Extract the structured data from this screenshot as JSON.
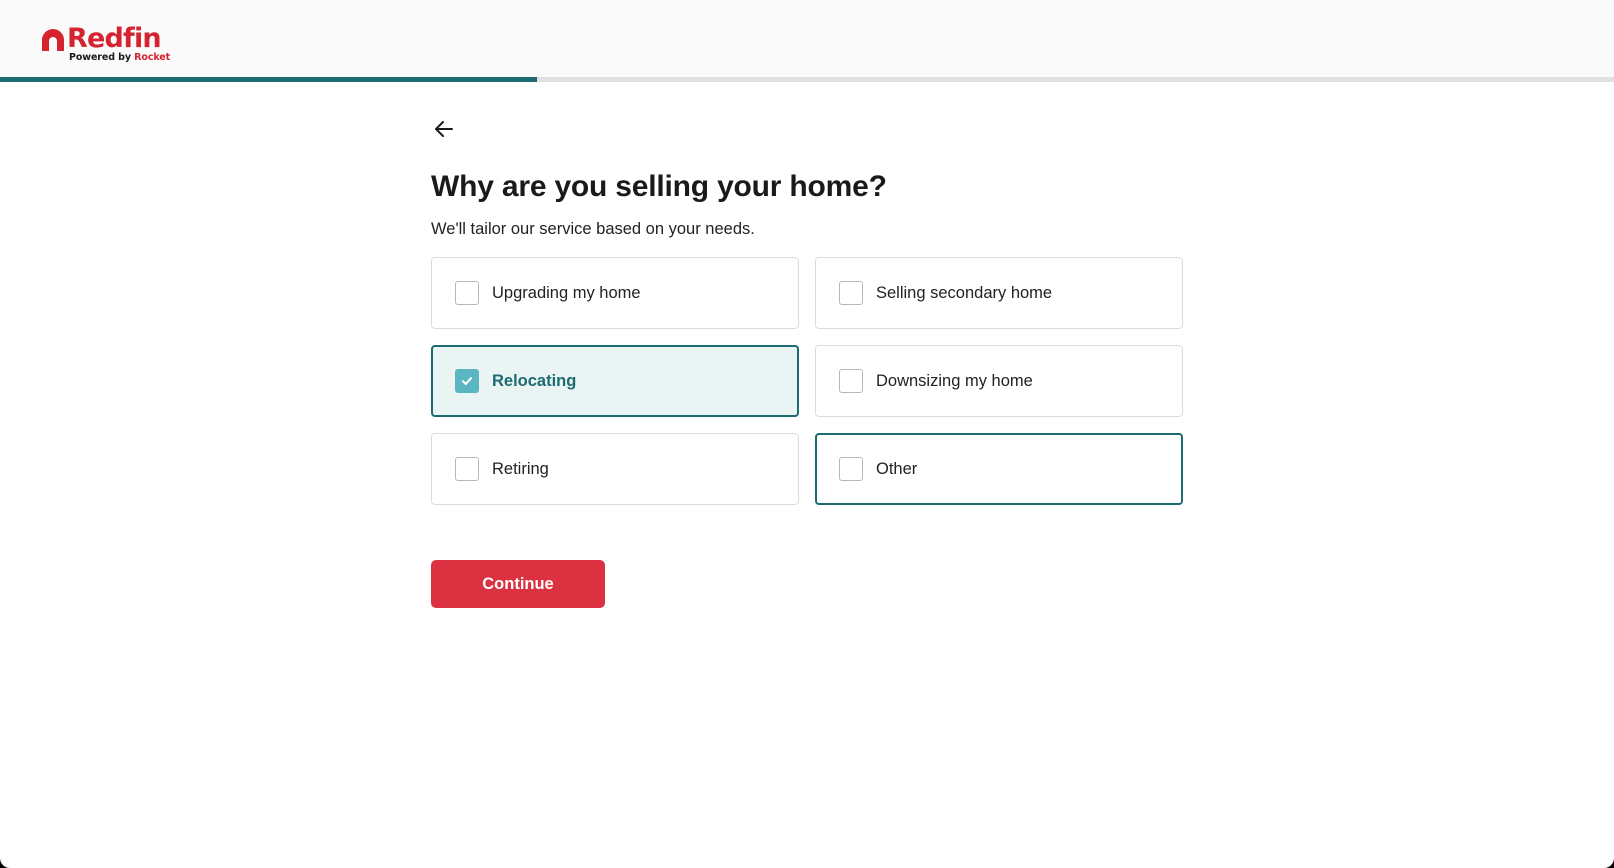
{
  "brand": {
    "name": "Redfin",
    "powered_by": "Powered by",
    "partner": "Rocket",
    "color": "#d5232f"
  },
  "progress": {
    "fraction": 0.333,
    "fill_color": "#1c6b73",
    "track_color": "#e0e0e0"
  },
  "navigation": {
    "back_icon": "arrow-left-icon"
  },
  "question": {
    "title": "Why are you selling your home?",
    "subtitle": "We'll tailor our service based on your needs."
  },
  "options": [
    {
      "label": "Upgrading my home",
      "checked": false
    },
    {
      "label": "Selling secondary home",
      "checked": false
    },
    {
      "label": "Relocating",
      "checked": true
    },
    {
      "label": "Downsizing my home",
      "checked": false
    },
    {
      "label": "Retiring",
      "checked": false
    },
    {
      "label": "Other",
      "checked": false,
      "focused": true
    }
  ],
  "actions": {
    "continue_label": "Continue",
    "continue_color": "#dc3140"
  },
  "colors": {
    "accent": "#1c6b73",
    "checkbox_checked": "#5ab6c0",
    "selected_background": "#eaf4f3"
  }
}
